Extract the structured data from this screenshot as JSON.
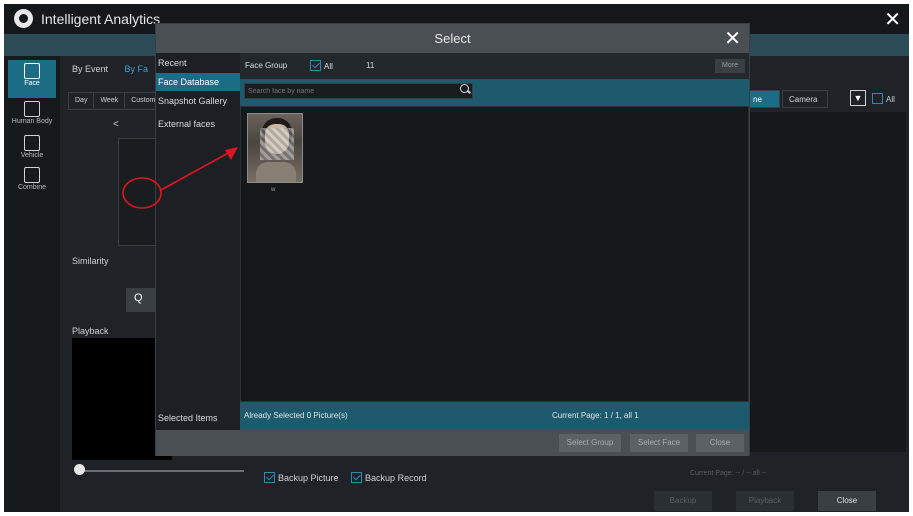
{
  "app": {
    "title": "Intelligent Analytics",
    "close_glyph": "✕"
  },
  "leftnav": [
    {
      "label": "Face",
      "icon": "face-icon"
    },
    {
      "label": "Human Body",
      "icon": "human-body-icon"
    },
    {
      "label": "Vehicle",
      "icon": "vehicle-icon"
    },
    {
      "label": "Combine",
      "icon": "combine-icon"
    }
  ],
  "main": {
    "tabs": [
      "By Event",
      "By Fa"
    ],
    "period": [
      "Day",
      "Week",
      "Custom"
    ],
    "prev_arrow": "<",
    "similarity_label": "Similarity",
    "search_button": "Q",
    "playback_label": "Playback",
    "backup_picture": "Backup Picture",
    "backup_record": "Backup Record",
    "page_info": "Current Page: -- / --  all --",
    "backup_button": "Backup",
    "playback_button": "Playback",
    "close_button": "Close",
    "right_tab_time": "ne",
    "right_tab_camera": "Camera",
    "filter_glyph": "▼",
    "right_all": "All"
  },
  "dialog": {
    "title": "Select",
    "close_glyph": "✕",
    "sidebar": [
      "Recent",
      "Face Database",
      "Snapshot Gallery",
      "External faces"
    ],
    "selected_items": "Selected Items",
    "face_group_label": "Face Group",
    "all_label": "All",
    "count": "11",
    "more_button": "More",
    "search_placeholder": "Search face by name",
    "thumb_label": "w",
    "selected_status": "Already Selected 0 Picture(s)",
    "page_status": "Current Page: 1 / 1, all 1",
    "select_group": "Select Group",
    "select_face": "Select Face",
    "close": "Close"
  },
  "colors": {
    "accent": "#1c6c86",
    "annotation": "#e0141e"
  }
}
